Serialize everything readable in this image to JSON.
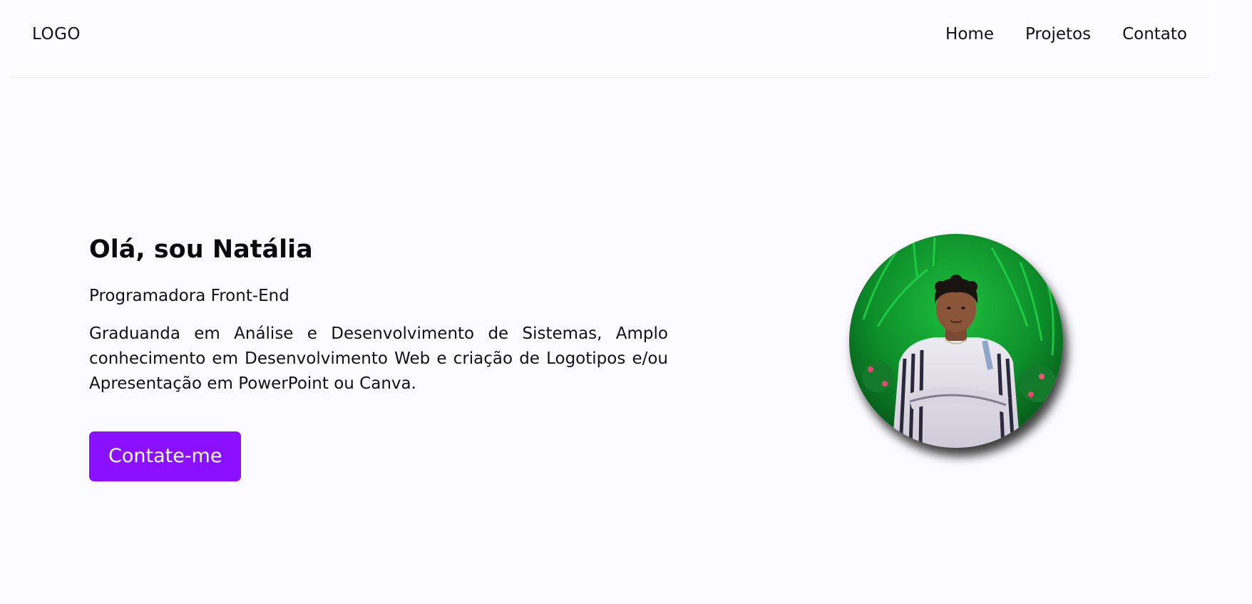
{
  "header": {
    "logo": "LOGO",
    "nav": [
      {
        "label": "Home"
      },
      {
        "label": "Projetos"
      },
      {
        "label": "Contato"
      }
    ]
  },
  "hero": {
    "title": "Olá, sou Natália",
    "role": "Programadora Front-End",
    "description": "Graduanda em Análise e Desenvolvimento de Sistemas, Amplo conhecimento em Desenvolvimento Web e criação de Logotipos e/ou Apresentação em PowerPoint ou Canva.",
    "cta_label": "Contate-me"
  },
  "colors": {
    "accent": "#8a10ff",
    "background": "#fcfbff"
  }
}
